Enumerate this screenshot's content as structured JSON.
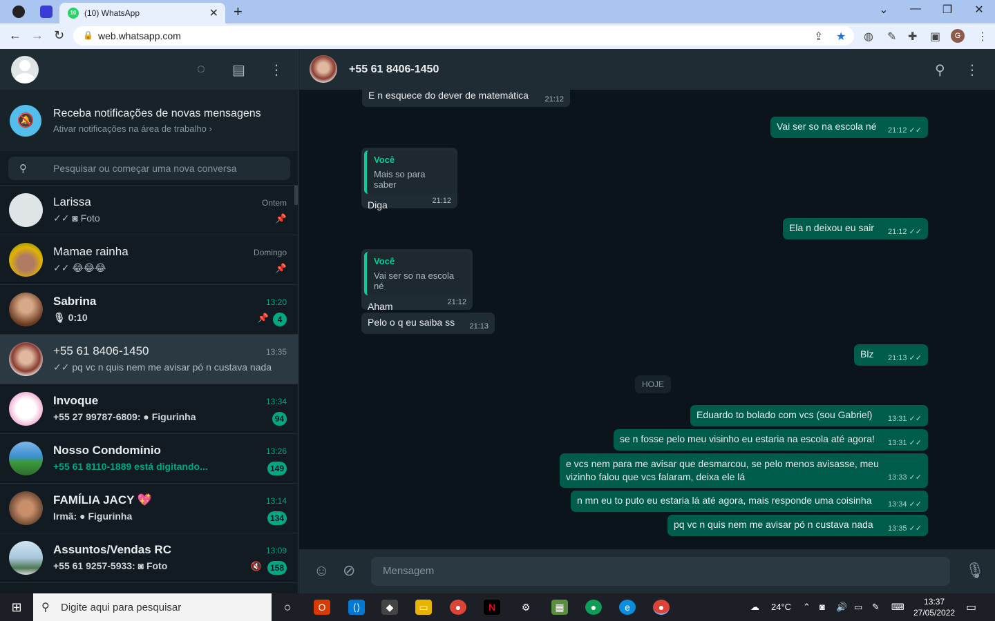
{
  "browser": {
    "tab_title": "(10) WhatsApp",
    "tab_badge": "10",
    "url": "web.whatsapp.com"
  },
  "sidebar": {
    "notification": {
      "title": "Receba notificações de novas mensagens",
      "subtitle": "Ativar notificações na área de trabalho ›"
    },
    "search_placeholder": "Pesquisar ou começar uma nova conversa",
    "chats": [
      {
        "name": "Larissa",
        "msg": "✓✓ ◙ Foto",
        "time": "Ontem",
        "pinned": true,
        "badge": ""
      },
      {
        "name": "Mamae rainha",
        "msg": "✓✓ 😂😂😂",
        "time": "Domingo",
        "pinned": true,
        "badge": ""
      },
      {
        "name": "Sabrina",
        "msg": "🎙 0:10",
        "time": "13:20",
        "pinned": true,
        "badge": "4"
      },
      {
        "name": "+55 61 8406-1450",
        "msg": "✓✓ pq vc n quis nem me avisar pó n custava nada",
        "time": "13:35",
        "pinned": false,
        "badge": ""
      },
      {
        "name": "Invoque",
        "msg": "+55 27 99787-6809: ● Figurinha",
        "time": "13:34",
        "pinned": false,
        "badge": "94"
      },
      {
        "name": "Nosso Condomínio",
        "msg": "+55 61 8110-1889 está digitando...",
        "time": "13:26",
        "pinned": false,
        "badge": "149"
      },
      {
        "name": "FAMÍLIA JACY 💖",
        "msg": "Irmã: ● Figurinha",
        "time": "13:14",
        "pinned": false,
        "badge": "134"
      },
      {
        "name": "Assuntos/Vendas RC",
        "msg": "+55 61 9257-5933: ◙ Foto",
        "time": "13:09",
        "pinned": false,
        "badge": "158"
      }
    ]
  },
  "conversation": {
    "contact": "+55 61 8406-1450",
    "day_divider": "HOJE",
    "messages": [
      {
        "dir": "in",
        "text": "E n esquece do dever de matemática",
        "time": "21:12"
      },
      {
        "dir": "out",
        "text": "Vai ser so na escola né",
        "time": "21:12 ✓✓"
      },
      {
        "dir": "in",
        "quote_who": "Você",
        "quote_text": "Mais so para saber",
        "text": "Diga",
        "time": "21:12"
      },
      {
        "dir": "out",
        "text": "Ela n deixou eu sair",
        "time": "21:12 ✓✓"
      },
      {
        "dir": "in",
        "quote_who": "Você",
        "quote_text": "Vai ser so na escola né",
        "text": "Aham",
        "time": "21:12"
      },
      {
        "dir": "in",
        "text": "Pelo o q eu saiba ss",
        "time": "21:13"
      },
      {
        "dir": "out",
        "text": "Blz",
        "time": "21:13 ✓✓"
      },
      {
        "dir": "out",
        "text": "Eduardo to bolado com vcs (sou Gabriel)",
        "time": "13:31 ✓✓"
      },
      {
        "dir": "out",
        "text": "se n fosse pelo meu visinho eu estaria na escola até agora!",
        "time": "13:31 ✓✓"
      },
      {
        "dir": "out",
        "text": "e vcs nem para me avisar que desmarcou, se pelo menos avisasse, meu vizinho falou que vcs falaram, deixa ele lá",
        "time": "13:33 ✓✓"
      },
      {
        "dir": "out",
        "text": "n mn eu to puto eu estaria lá até agora, mais responde uma coisinha",
        "time": "13:34 ✓✓"
      },
      {
        "dir": "out",
        "text": "pq vc n quis nem me avisar pó n custava nada",
        "time": "13:35 ✓✓"
      }
    ],
    "input_placeholder": "Mensagem"
  },
  "taskbar": {
    "search_placeholder": "Digite aqui para pesquisar",
    "weather": "24°C",
    "time": "13:37",
    "date": "27/05/2022"
  },
  "colors": {
    "accent": "#00a884",
    "outgoing_bubble": "#005c4b",
    "incoming_bubble": "#202c33"
  }
}
